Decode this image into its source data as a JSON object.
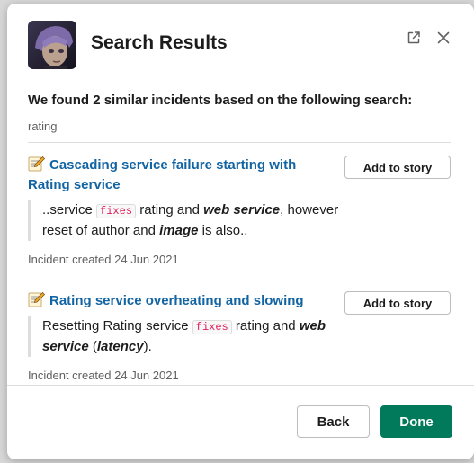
{
  "modal": {
    "title": "Search Results",
    "open_icon": "external-link-icon",
    "close_icon": "close-icon",
    "avatar": "character-avatar"
  },
  "intro": "We found 2 similar incidents based on the following search:",
  "query": "rating",
  "incidents": [
    {
      "icon": "memo-icon",
      "title": "Cascading service failure starting with Rating service",
      "button_label": "Add to story",
      "snippet": {
        "p1": "..service ",
        "code": "fixes",
        "p2": " rating and ",
        "b1": "web service",
        "p3": ", however reset of author and ",
        "b2": "image",
        "p4": " is also.."
      },
      "created": "Incident created 24 Jun 2021"
    },
    {
      "icon": "memo-icon",
      "title": "Rating service overheating and slowing",
      "button_label": "Add to story",
      "snippet": {
        "p1": "Resetting Rating service ",
        "code": "fixes",
        "p2": " rating and ",
        "b1": "web service",
        "p3": " (",
        "b2": "latency",
        "p4": ")."
      },
      "created": "Incident created 24 Jun 2021"
    }
  ],
  "footer": {
    "back_label": "Back",
    "done_label": "Done"
  },
  "colors": {
    "link": "#1264a3",
    "primary": "#007a5a",
    "code_text": "#e01e5a"
  }
}
